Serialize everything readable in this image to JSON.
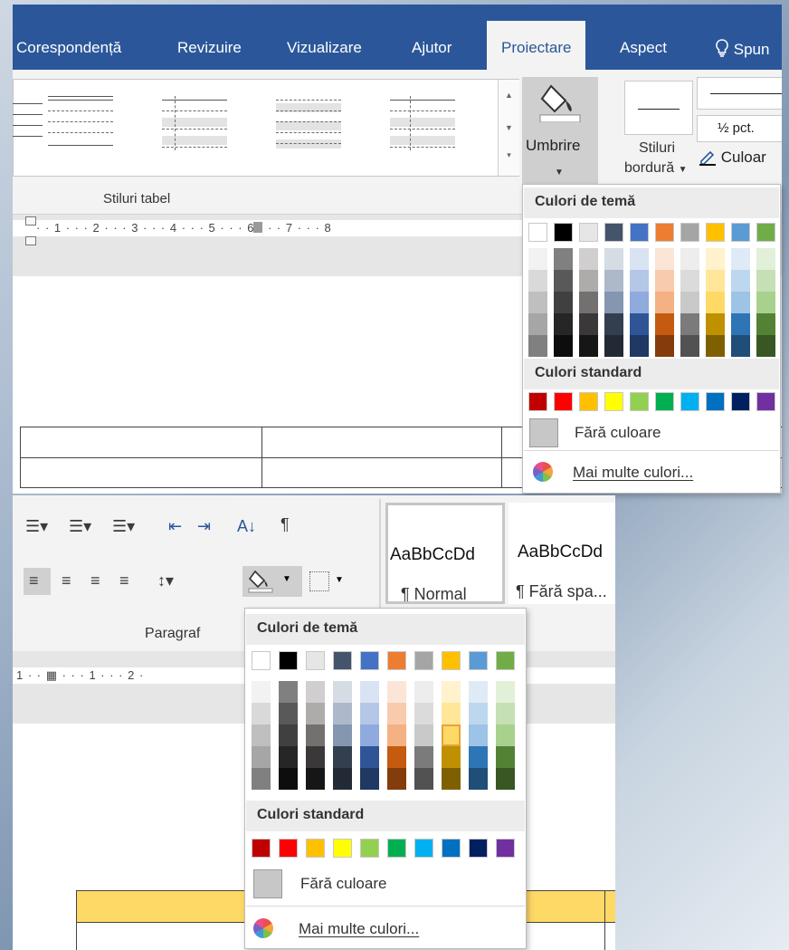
{
  "shot1": {
    "tabs": [
      {
        "label": "Corespondență"
      },
      {
        "label": "Revizuire"
      },
      {
        "label": "Vizualizare"
      },
      {
        "label": "Ajutor"
      },
      {
        "label": "Proiectare",
        "active": true
      },
      {
        "label": "Aspect"
      },
      {
        "label": "Spun"
      }
    ],
    "ribbon": {
      "table_styles_label": "Stiluri tabel",
      "shading_label": "Umbrire",
      "border_styles_label_1": "Stiluri",
      "border_styles_label_2": "bordură",
      "pen_weight": "½ pct.",
      "pen_color_label": "Culoar"
    },
    "ruler_text": "· · 1 · · · 2 · · · 3 · · · 4 · · · 5 · · · 6 · · · 7 · · · 8"
  },
  "shot2": {
    "ribbon": {
      "paragraph_label": "Paragraf",
      "style_normal_sample": "AaBbCcDd",
      "style_normal_name": "¶ Normal",
      "style_nospace_sample": "AaBbCcDd",
      "style_nospace_name": "¶ Fără spa..."
    },
    "ruler_text": "1 · · ▦  · · · 1 · · · 2 ·"
  },
  "color_picker": {
    "theme_header": "Culori de temă",
    "standard_header": "Culori standard",
    "no_color_label": "Fără culoare",
    "more_colors_label": "Mai multe culori...",
    "theme_top_row": [
      "#ffffff",
      "#000000",
      "#e7e6e6",
      "#44546a",
      "#4472c4",
      "#ed7d31",
      "#a5a5a5",
      "#ffc000",
      "#5b9bd5",
      "#70ad47"
    ],
    "theme_shades": [
      [
        "#f2f2f2",
        "#d9d9d9",
        "#bfbfbf",
        "#a6a6a6",
        "#808080"
      ],
      [
        "#808080",
        "#595959",
        "#404040",
        "#262626",
        "#0d0d0d"
      ],
      [
        "#d0cece",
        "#aeabab",
        "#757070",
        "#3a3838",
        "#171616"
      ],
      [
        "#d6dce4",
        "#adb9ca",
        "#8496b0",
        "#333f4f",
        "#222a35"
      ],
      [
        "#dae3f3",
        "#b4c7e7",
        "#8faadc",
        "#2f5597",
        "#1f3864"
      ],
      [
        "#fbe5d6",
        "#f8cbad",
        "#f4b183",
        "#c55a11",
        "#843c0c"
      ],
      [
        "#ededed",
        "#dbdbdb",
        "#c9c9c9",
        "#7b7b7b",
        "#525252"
      ],
      [
        "#fff2cc",
        "#ffe699",
        "#ffd966",
        "#bf9000",
        "#7f6000"
      ],
      [
        "#deebf7",
        "#bdd7ee",
        "#9dc3e6",
        "#2e75b6",
        "#1f4e79"
      ],
      [
        "#e2f0d9",
        "#c5e0b4",
        "#a9d18e",
        "#548235",
        "#385723"
      ]
    ],
    "standard_colors": [
      "#c00000",
      "#ff0000",
      "#ffc000",
      "#ffff00",
      "#92d050",
      "#00b050",
      "#00b0f0",
      "#0070c0",
      "#002060",
      "#7030a0"
    ],
    "selected_color": "#ffd966"
  }
}
